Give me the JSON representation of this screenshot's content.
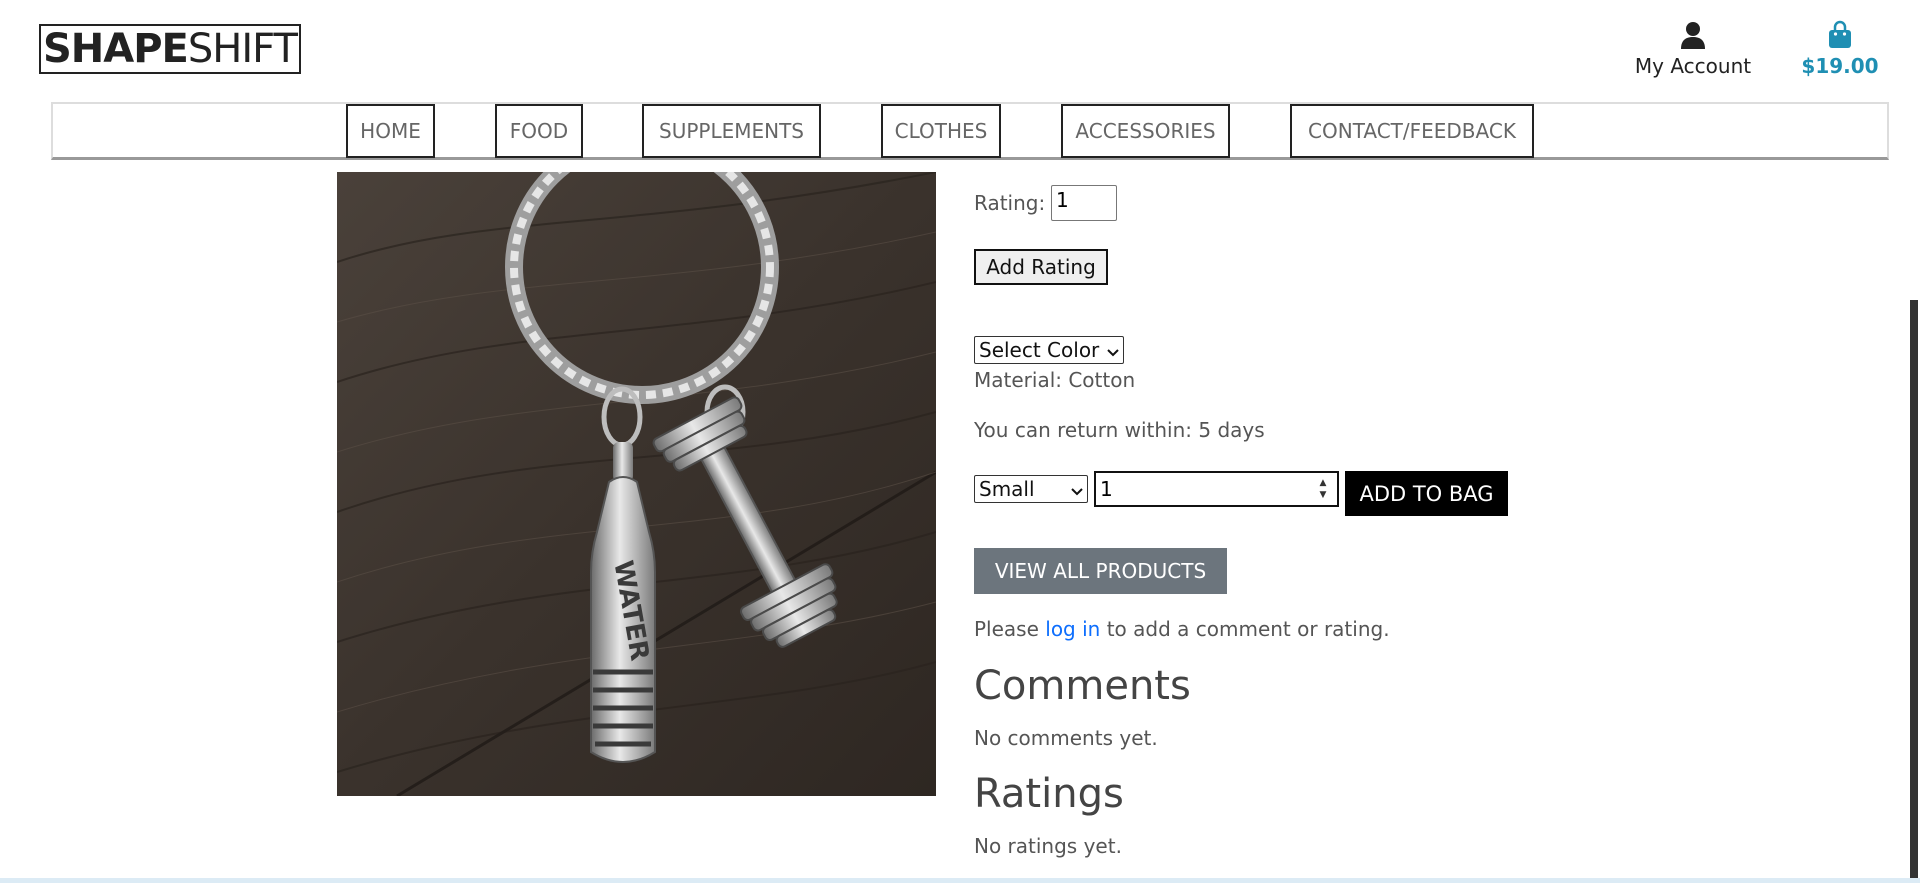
{
  "header": {
    "logo_bold": "SHAPE",
    "logo_light": "SHIFT",
    "account_label": "My Account",
    "bag_total": "$19.00"
  },
  "nav": {
    "items": [
      "HOME",
      "FOOD",
      "SUPPLEMENTS",
      "CLOTHES",
      "ACCESSORIES",
      "CONTACT/FEEDBACK"
    ]
  },
  "product": {
    "rating_label": "Rating:",
    "rating_value": "1",
    "add_rating_label": "Add Rating",
    "color_select": "Select Color",
    "material": "Material: Cotton",
    "return_policy": "You can return within: 5 days",
    "size_select": "Small",
    "quantity": "1",
    "add_to_bag_label": "ADD TO BAG",
    "view_all_label": "VIEW ALL PRODUCTS",
    "login_prompt_before": "Please ",
    "login_link": "log in",
    "login_prompt_after": " to add a comment or rating.",
    "comments_heading": "Comments",
    "comments_empty": "No comments yet.",
    "ratings_heading": "Ratings",
    "ratings_empty": "No ratings yet.",
    "image_engraving": "WATER"
  },
  "colors": {
    "accent_blue": "#1f8fb3",
    "link_blue": "#0d6efd",
    "view_all_grey": "#6c757d",
    "text": "#555555"
  },
  "icons": {
    "account": "user-icon",
    "bag": "shopping-bag-icon"
  }
}
